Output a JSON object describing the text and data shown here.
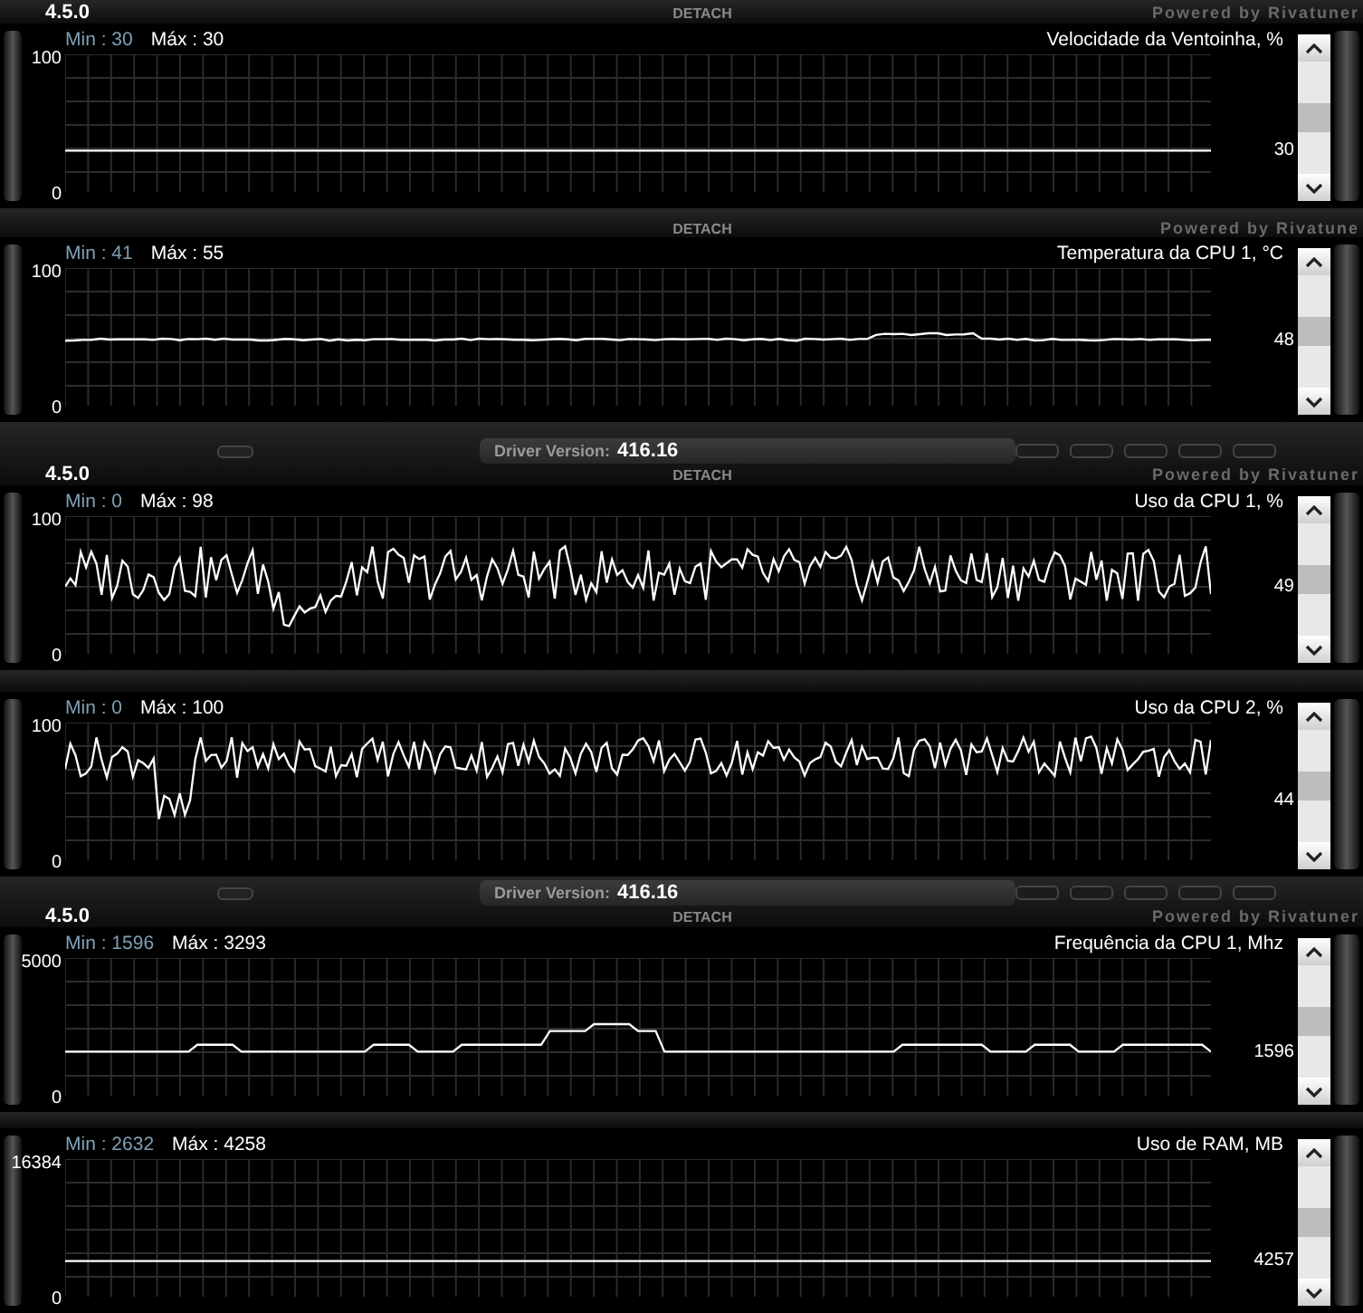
{
  "panels": [
    {
      "header": {
        "kind": "top",
        "version": "4.5.0",
        "detach": "DETACH",
        "powered": "Powered by Rivatuner"
      },
      "min": "Min : 30",
      "max": "Máx : 30",
      "title": "Velocidade da Ventoinha, %",
      "y_max": "100",
      "y_min": "0",
      "current": "30",
      "kind": "flat"
    },
    {
      "header": {
        "kind": "strip",
        "detach": "DETACH",
        "powered": "Powered by Rivatune"
      },
      "min": "Min : 41",
      "max": "Máx : 55",
      "title": "Temperatura da CPU 1, °C",
      "y_max": "100",
      "y_min": "0",
      "current": "48",
      "kind": "drift"
    },
    {
      "header": {
        "kind": "driver",
        "version": "4.5.0",
        "driver_label": "Driver Version:",
        "driver_version": "416.16",
        "detach": "DETACH",
        "powered": "Powered by Rivatuner"
      },
      "min": "Min : 0",
      "max": "Máx : 98",
      "title": "Uso da CPU 1, %",
      "y_max": "100",
      "y_min": "0",
      "current": "49",
      "kind": "noise"
    },
    {
      "header": {
        "kind": "plain"
      },
      "min": "Min : 0",
      "max": "Máx : 100",
      "title": "Uso da CPU 2, %",
      "y_max": "100",
      "y_min": "0",
      "current": "44",
      "kind": "noise_high"
    },
    {
      "header": {
        "kind": "driver_short",
        "version": "4.5.0",
        "driver_label": "Driver Version:",
        "driver_version": "416.16",
        "detach": "DETACH",
        "powered": "Powered by Rivatuner"
      },
      "min": "Min : 1596",
      "max": "Máx : 3293",
      "title": "Frequência da CPU 1, Mhz",
      "y_max": "5000",
      "y_min": "0",
      "current": "1596",
      "kind": "steps"
    },
    {
      "header": {
        "kind": "thin"
      },
      "min": "Min : 2632",
      "max": "Máx : 4258",
      "title": "Uso de RAM, MB",
      "y_max": "16384",
      "y_min": "0",
      "current": "4257",
      "kind": "flat"
    }
  ]
}
